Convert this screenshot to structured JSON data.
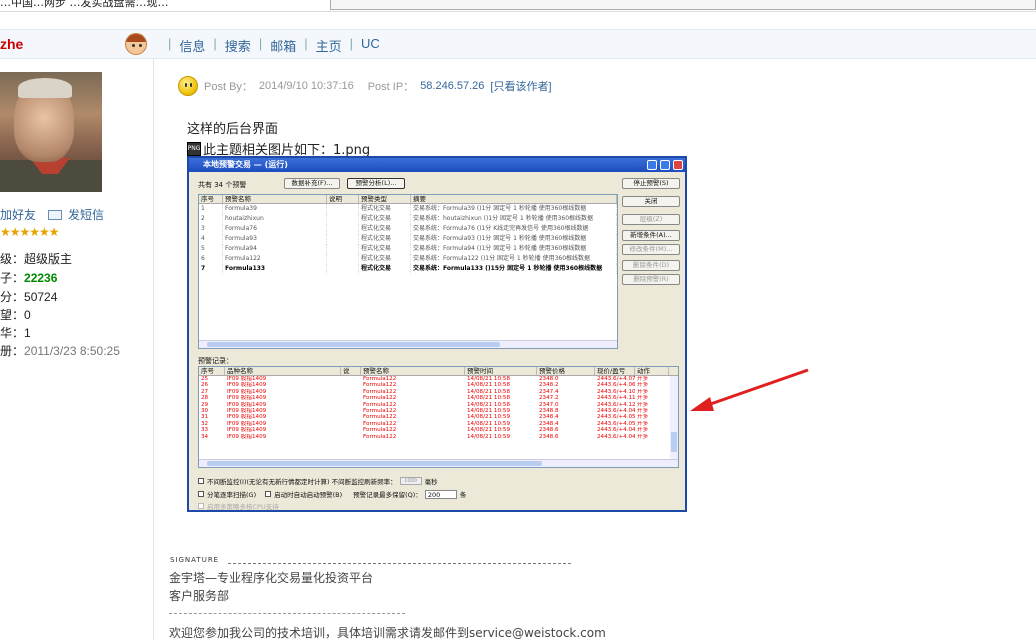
{
  "browser": {
    "tab_title": "…中国…网步 …发实战盘需…现…",
    "address_value": ""
  },
  "user": {
    "name": "zhe",
    "add_friend": "加好友",
    "send_message": "发短信",
    "stars": "★★★★★★",
    "rank_label": "级：超级版主",
    "posts_label": "子：",
    "posts": "22236",
    "points_label": "分：",
    "points": "50724",
    "p3_label": "望：",
    "p3": "0",
    "p4_label": "华：",
    "p4": "1",
    "reg_label": "册：",
    "reg": "2011/3/23 8:50:25"
  },
  "nav": {
    "items": [
      "信息",
      "搜索",
      "邮箱",
      "主页",
      "UC"
    ]
  },
  "post": {
    "by_label": "Post By：",
    "by_time": "2014/9/10 10:37:16",
    "ip_label": "Post IP：",
    "ip": "58.246.57.26",
    "only_author": "[只看该作者]",
    "line1": "这样的后台界面",
    "attach": "此主题相关图片如下：1.png"
  },
  "screenshot": {
    "title": "本地预警交易 — (运行)",
    "count": "共有 34 个预警",
    "btn_data": "数据补充(F)...",
    "btn_analyze": "预警分析(L)...",
    "cols": [
      "序号",
      "预警名称",
      "说明",
      "预警类型",
      "摘要"
    ],
    "rows": [
      [
        "1",
        "Formula39",
        "",
        "程式化交易",
        "交易系统：Formula39 ()1分 固定号 1 秒轮播 使用360根线数据"
      ],
      [
        "2",
        "houtaizhixun",
        "",
        "程式化交易",
        "交易系统：houtaizhixun ()1分 固定号 1 秒轮播 使用360根线数据"
      ],
      [
        "3",
        "Formula76",
        "",
        "程式化交易",
        "交易系统：Formula76 ()1分 K线走完再发信号 使用360根线数据"
      ],
      [
        "4",
        "Formula93",
        "",
        "程式化交易",
        "交易系统：Formula93 ()1分 固定号 1 秒轮播 使用360根线数据"
      ],
      [
        "5",
        "Formula94",
        "",
        "程式化交易",
        "交易系统：Formula94 ()1分 固定号 1 秒轮播 使用360根线数据"
      ],
      [
        "6",
        "Formula122",
        "",
        "程式化交易",
        "交易系统：Formula122 ()1分 固定号 1 秒轮播 使用360根线数据"
      ],
      [
        "7",
        "Formula133",
        "",
        "程式化交易",
        "交易系统：Formula133 ()15分 固定号 1 秒轮播 使用360根线数据"
      ]
    ],
    "side_buttons": [
      "停止预警(S)",
      "关闭",
      "层级(Z)",
      "新增条件(A)...",
      "修改条件(M)...",
      "删除条件(D)",
      "删除预警(R)"
    ],
    "records_label": "预警记录：",
    "rcols": [
      "序号",
      "品种名称",
      "说",
      "预警名称",
      "预警时间",
      "预警价格",
      "现价/盈亏",
      "动作"
    ],
    "records": [
      [
        "25",
        "IF09 股指1409",
        "",
        "Formula122",
        "14/08/21 10:58",
        "2348.0",
        "2443.6/+4.07%",
        "开多"
      ],
      [
        "26",
        "IF09 股指1409",
        "",
        "Formula122",
        "14/08/21 10:58",
        "2348.2",
        "2443.6/+4.06%",
        "开多"
      ],
      [
        "27",
        "IF09 股指1409",
        "",
        "Formula122",
        "14/08/21 10:58",
        "2347.4",
        "2443.6/+4.10%",
        "开多"
      ],
      [
        "28",
        "IF09 股指1409",
        "",
        "Formula122",
        "14/08/21 10:58",
        "2347.2",
        "2443.6/+4.11%",
        "开多"
      ],
      [
        "29",
        "IF09 股指1409",
        "",
        "Formula122",
        "14/08/21 10:58",
        "2347.0",
        "2443.6/+4.12%",
        "开多"
      ],
      [
        "30",
        "IF09 股指1409",
        "",
        "Formula122",
        "14/08/21 10:59",
        "2348.8",
        "2443.6/+4.04%",
        "开多"
      ],
      [
        "31",
        "IF09 股指1409",
        "",
        "Formula122",
        "14/08/21 10:59",
        "2348.4",
        "2443.6/+4.05%",
        "开多"
      ],
      [
        "32",
        "IF09 股指1409",
        "",
        "Formula122",
        "14/08/21 10:59",
        "2348.4",
        "2443.6/+4.05%",
        "开多"
      ],
      [
        "33",
        "IF09 股指1409",
        "",
        "Formula122",
        "14/08/21 10:59",
        "2348.6",
        "2443.6/+4.04%",
        "开多"
      ],
      [
        "34",
        "IF09 股指1409",
        "",
        "Formula122",
        "14/08/21 10:59",
        "2348.6",
        "2443.6/+4.04%",
        "开多"
      ]
    ],
    "opt1": "不间断监控(I)(无论有无新行情都定时计算)  不间断监控刷新频率：",
    "opt1_val": "1000",
    "opt1_unit": "毫秒",
    "opt2": "分笔逐率扫描(G)",
    "opt3": "启动时自动启动预警(B)",
    "opt4_label": "预警记录最多保留(Q)：",
    "opt4_val": "200",
    "opt4_unit": "条",
    "opt5": "启用多策略多核CPU支持"
  },
  "signature": {
    "tag": "SIGNATURE",
    "line1": "金宇塔—专业程序化交易量化投资平台",
    "line2": "客户服务部",
    "line3": "欢迎您参加我公司的技术培训，具体培训需求请发邮件到service@weistock.com"
  },
  "colors": {
    "link": "#336699",
    "green": "#008800",
    "arrow": "#e02020"
  }
}
